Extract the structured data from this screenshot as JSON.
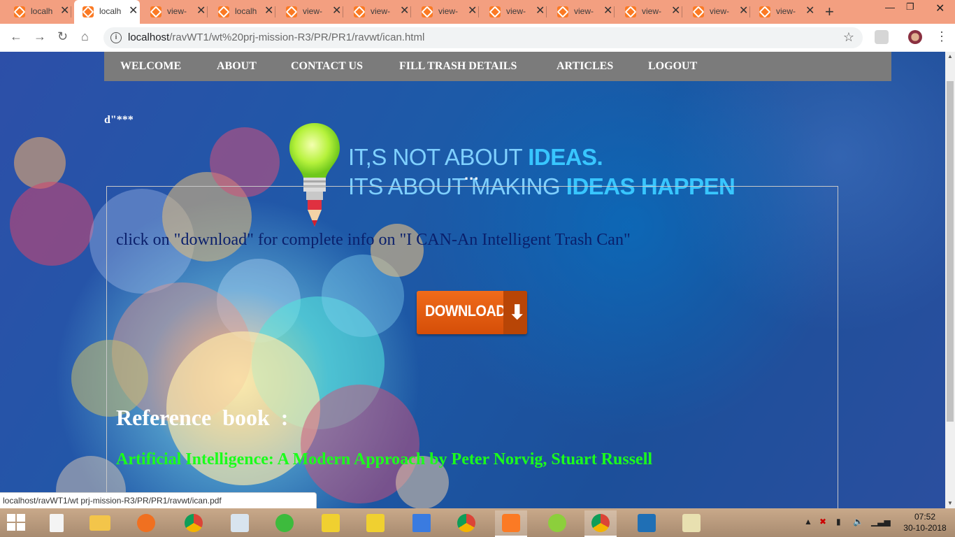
{
  "browser": {
    "tabs": [
      {
        "label": "localh",
        "active": false
      },
      {
        "label": "localh",
        "active": true
      },
      {
        "label": "view-",
        "active": false
      },
      {
        "label": "localh",
        "active": false
      },
      {
        "label": "view-",
        "active": false
      },
      {
        "label": "view-",
        "active": false
      },
      {
        "label": "view-",
        "active": false
      },
      {
        "label": "view-",
        "active": false
      },
      {
        "label": "view-",
        "active": false
      },
      {
        "label": "view-",
        "active": false
      },
      {
        "label": "view-",
        "active": false
      },
      {
        "label": "view-",
        "active": false
      }
    ],
    "url_host": "localhost",
    "url_path": "/ravWT1/wt%20prj-mission-R3/PR/PR1/ravwt/ican.html"
  },
  "page": {
    "nav": [
      "WELCOME",
      "ABOUT",
      "CONTACT US",
      "FILL TRASH DETAILS",
      "ARTICLES",
      "LOGOUT"
    ],
    "stars_text": "d\"***",
    "banner": {
      "line1_a": "IT,S NOT ABOUT ",
      "line1_b": "IDEAS.",
      "line2_a": "ITS ABOUT  MAKING ",
      "line2_b": "IDEAS HAPPEN",
      "dots": "..."
    },
    "info_text": "click on \"download\" for complete info on \"I CAN-An Intelligent Trash Can\"",
    "download_label": "DOWNLOAD",
    "reference_title": "Reference  book  :",
    "reference_book": "Artificial Intelligence: A Modern Approach by Peter Norvig, Stuart Russell",
    "status_url": "localhost/ravWT1/wt prj-mission-R3/PR/PR1/ravwt/ican.pdf"
  },
  "taskbar": {
    "clock_time": "07:52",
    "clock_date": "30-10-2018"
  }
}
